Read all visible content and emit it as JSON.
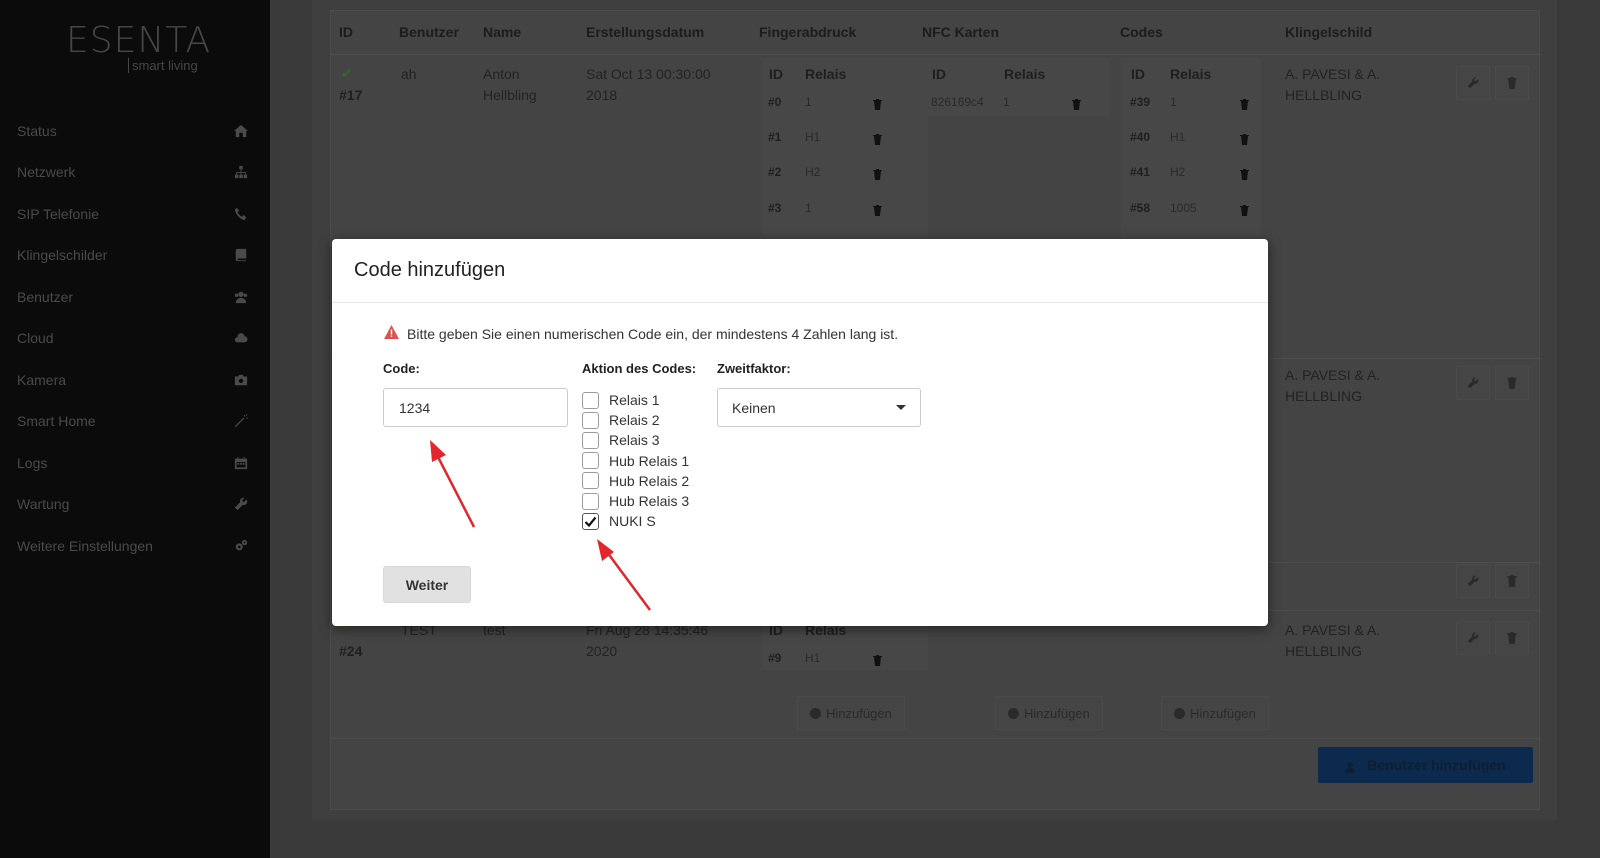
{
  "brand": {
    "name": "ESENTA",
    "tagline": "smart living"
  },
  "sidebar": {
    "items": [
      {
        "label": "Status",
        "icon": "home-icon"
      },
      {
        "label": "Netzwerk",
        "icon": "sitemap-icon"
      },
      {
        "label": "SIP Telefonie",
        "icon": "phone-icon"
      },
      {
        "label": "Klingelschilder",
        "icon": "book-icon"
      },
      {
        "label": "Benutzer",
        "icon": "users-icon"
      },
      {
        "label": "Cloud",
        "icon": "cloud-icon"
      },
      {
        "label": "Kamera",
        "icon": "camera-icon"
      },
      {
        "label": "Smart Home",
        "icon": "wand-icon"
      },
      {
        "label": "Logs",
        "icon": "calendar-icon"
      },
      {
        "label": "Wartung",
        "icon": "wrench-icon"
      },
      {
        "label": "Weitere Einstellungen",
        "icon": "cogs-icon"
      }
    ]
  },
  "table": {
    "headers": [
      "ID",
      "Benutzer",
      "Name",
      "Erstellungsdatum",
      "Fingerabdruck",
      "NFC Karten",
      "Codes",
      "Klingelschild"
    ],
    "sub_id": "ID",
    "sub_relais": "Relais",
    "row1": {
      "id": "#17",
      "user": "ah",
      "name_line1": "Anton",
      "name_line2": "Hellbling",
      "date_line1": "Sat Oct 13 00:30:00",
      "date_line2": "2018",
      "fingerprints": [
        {
          "id": "#0",
          "relais": "1"
        },
        {
          "id": "#1",
          "relais": "H1"
        },
        {
          "id": "#2",
          "relais": "H2"
        },
        {
          "id": "#3",
          "relais": "1"
        }
      ],
      "nfc": [
        {
          "id": "826169c4",
          "relais": "1"
        }
      ],
      "codes": [
        {
          "id": "#39",
          "relais": "1"
        },
        {
          "id": "#40",
          "relais": "H1"
        },
        {
          "id": "#41",
          "relais": "H2"
        },
        {
          "id": "#58",
          "relais": "1005"
        }
      ],
      "bell_line1": "A. PAVESI & A.",
      "bell_line2": "HELLBLING"
    },
    "row2": {
      "bell_line1": "A. PAVESI & A.",
      "bell_line2": "HELLBLING"
    },
    "row4": {
      "id": "#24",
      "user": "TEST",
      "name": "test",
      "date_line1": "Fri Aug 28 14:35:46",
      "date_line2": "2020",
      "fingerprints": [
        {
          "id": "#9",
          "relais": "H1"
        }
      ],
      "bell_line1": "A. PAVESI & A.",
      "bell_line2": "HELLBLING"
    },
    "add_label": "Hinzufügen",
    "add_user_label": "Benutzer hinzufügen"
  },
  "modal": {
    "title": "Code hinzufügen",
    "alert": "Bitte geben Sie einen numerischen Code ein, der mindestens 4 Zahlen lang ist.",
    "code_label": "Code:",
    "code_value": "1234",
    "action_label": "Aktion des Codes:",
    "actions": [
      {
        "label": "Relais 1",
        "checked": false
      },
      {
        "label": "Relais 2",
        "checked": false
      },
      {
        "label": "Relais 3",
        "checked": false
      },
      {
        "label": "Hub Relais 1",
        "checked": false
      },
      {
        "label": "Hub Relais 2",
        "checked": false
      },
      {
        "label": "Hub Relais 3",
        "checked": false
      },
      {
        "label": "NUKI S",
        "checked": true
      }
    ],
    "second_factor_label": "Zweitfaktor:",
    "second_factor_value": "Keinen",
    "next_button": "Weiter"
  },
  "colors": {
    "alert": "#d9534f",
    "annotation": "#e3262b",
    "primary": "#0c2a4e"
  }
}
